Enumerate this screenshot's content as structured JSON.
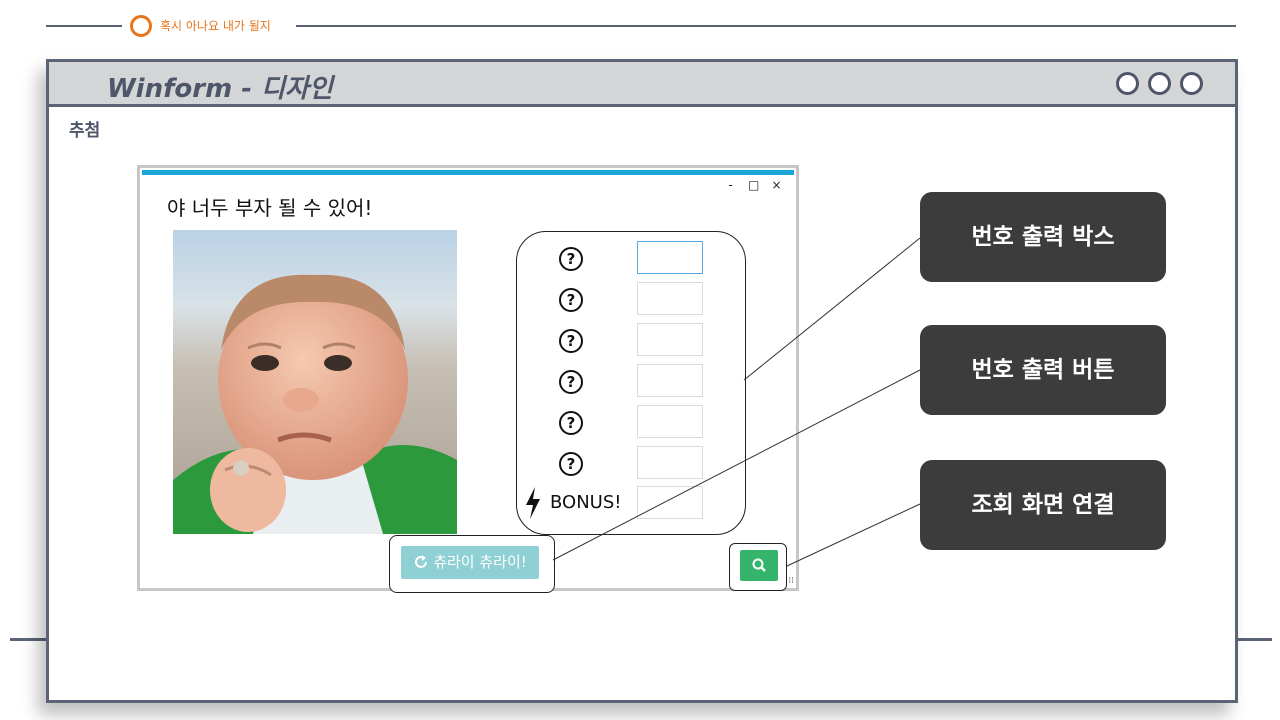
{
  "section": {
    "label": "혹시 아나요 내가 될지"
  },
  "frame": {
    "title": "Winform - 디자인",
    "subtitle": "추첨",
    "window_controls": [
      "circle-icon",
      "circle-icon",
      "circle-icon"
    ]
  },
  "form": {
    "heading": "야 너두 부자 될 수 있어!",
    "win_buttons": {
      "minimize": "-",
      "maximize": "□",
      "close": "×"
    },
    "rows": [
      {
        "icon": "question-circle-icon",
        "glyph": "?",
        "value": ""
      },
      {
        "icon": "question-circle-icon",
        "glyph": "?",
        "value": ""
      },
      {
        "icon": "question-circle-icon",
        "glyph": "?",
        "value": ""
      },
      {
        "icon": "question-circle-icon",
        "glyph": "?",
        "value": ""
      },
      {
        "icon": "question-circle-icon",
        "glyph": "?",
        "value": ""
      },
      {
        "icon": "question-circle-icon",
        "glyph": "?",
        "value": ""
      }
    ],
    "bonus": {
      "icon": "lightning-icon",
      "label": "BONUS!",
      "value": ""
    },
    "draw_button": {
      "icon": "refresh-icon",
      "label": "츄라이 츄라이!"
    },
    "search_button": {
      "icon": "search-icon"
    }
  },
  "callouts": {
    "number_box": "번호 출력 박스",
    "number_button": "번호 출력 버튼",
    "lookup_link": "조회 화면 연결"
  },
  "colors": {
    "accent_orange": "#e8751a",
    "frame_slate": "#5b6477",
    "form_accent": "#1aa6d9",
    "draw_button": "#8ed0d4",
    "search_button": "#35b46c",
    "callout_bg": "#3c3c3c"
  }
}
